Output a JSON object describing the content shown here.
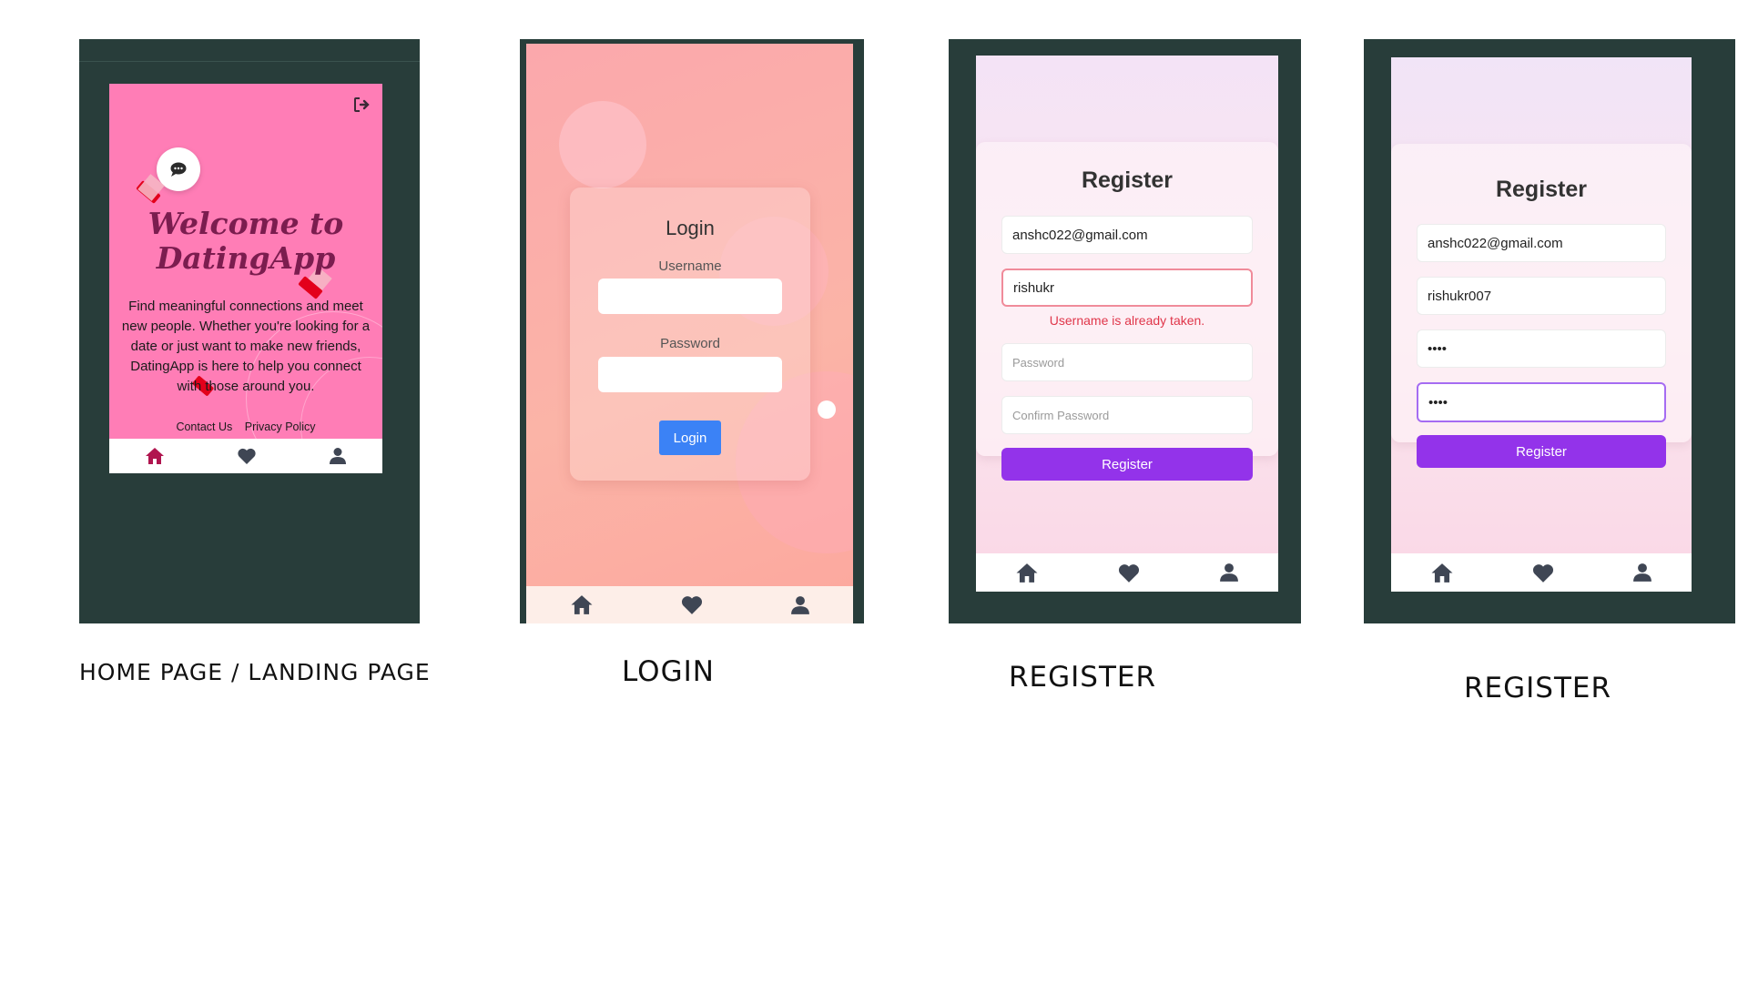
{
  "colors": {
    "frame": "#283d3a",
    "home_bg": "#ff7db6",
    "welcome_text": "#7b1d4f",
    "home_icon_active": "#b0154f",
    "login_bg": "#fbb3a9",
    "login_button": "#3b82f6",
    "register_button": "#9333ea",
    "error_red": "#e0364a",
    "nav_icon": "#3f4654"
  },
  "home": {
    "logout_icon": "logout-icon",
    "chat_icon": "chat-bubble-icon",
    "title_line1": "Welcome to",
    "title_line2": "DatingApp",
    "description": "Find meaningful connections and meet new people. Whether you're looking for a date or just want to make new friends, DatingApp is here to help you connect with those around you.",
    "links": [
      "Contact Us",
      "Privacy Policy"
    ],
    "caption": "HOME PAGE / LANDING PAGE"
  },
  "login": {
    "title": "Login",
    "username_label": "Username",
    "password_label": "Password",
    "username_value": "",
    "password_value": "",
    "button_label": "Login",
    "caption": "LOGIN"
  },
  "register1": {
    "title": "Register",
    "email_value": "anshc022@gmail.com",
    "username_value": "rishukr",
    "error_text": "Username is already taken.",
    "password_placeholder": "Password",
    "confirm_placeholder": "Confirm Password",
    "button_label": "Register",
    "caption": "REGISTER"
  },
  "register2": {
    "title": "Register",
    "email_value": "anshc022@gmail.com",
    "username_value": "rishukr007",
    "password_value": "••••",
    "confirm_value": "••••",
    "button_label": "Register",
    "caption": "REGISTER"
  },
  "nav": {
    "icons": [
      "home-icon",
      "heart-icon",
      "user-icon"
    ]
  }
}
